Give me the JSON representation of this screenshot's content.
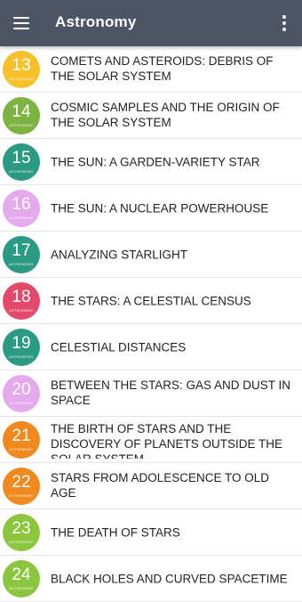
{
  "app": {
    "title": "Astronomy"
  },
  "chapters": [
    {
      "number": "13",
      "sublabel": "ASTRONOMY",
      "title": "COMETS AND ASTEROIDS: DEBRIS OF THE SOLAR SYSTEM",
      "color": "#f6c12b"
    },
    {
      "number": "14",
      "sublabel": "ASTRONOMY",
      "title": "COSMIC SAMPLES AND THE ORIGIN OF THE SOLAR SYSTEM",
      "color": "#7cb342"
    },
    {
      "number": "15",
      "sublabel": "ASTRONOMY",
      "title": "THE SUN: A GARDEN-VARIETY STAR",
      "color": "#2a9b82"
    },
    {
      "number": "16",
      "sublabel": "ASTRONOMY",
      "title": "THE SUN: A NUCLEAR POWERHOUSE",
      "color": "#e5a9ee"
    },
    {
      "number": "17",
      "sublabel": "ASTRONOMY",
      "title": "ANALYZING STARLIGHT",
      "color": "#2a9b82"
    },
    {
      "number": "18",
      "sublabel": "ASTRONOMY",
      "title": "THE STARS: A CELESTIAL CENSUS",
      "color": "#e2496a"
    },
    {
      "number": "19",
      "sublabel": "ASTRONOMY",
      "title": "CELESTIAL DISTANCES",
      "color": "#2a9b82"
    },
    {
      "number": "20",
      "sublabel": "ASTRONOMY",
      "title": "BETWEEN THE STARS: GAS AND DUST IN SPACE",
      "color": "#e5a9ee"
    },
    {
      "number": "21",
      "sublabel": "ASTRONOMY",
      "title": "THE BIRTH OF STARS AND THE DISCOVERY OF PLANETS OUTSIDE THE SOLAR SYSTEM",
      "color": "#f08a1e"
    },
    {
      "number": "22",
      "sublabel": "ASTRONOMY",
      "title": "STARS FROM ADOLESCENCE TO OLD AGE",
      "color": "#f08a1e"
    },
    {
      "number": "23",
      "sublabel": "ASTRONOMY",
      "title": "THE DEATH OF STARS",
      "color": "#8cc63f"
    },
    {
      "number": "24",
      "sublabel": "ASTRONOMY",
      "title": "BLACK HOLES AND CURVED SPACETIME",
      "color": "#8cc63f"
    }
  ]
}
